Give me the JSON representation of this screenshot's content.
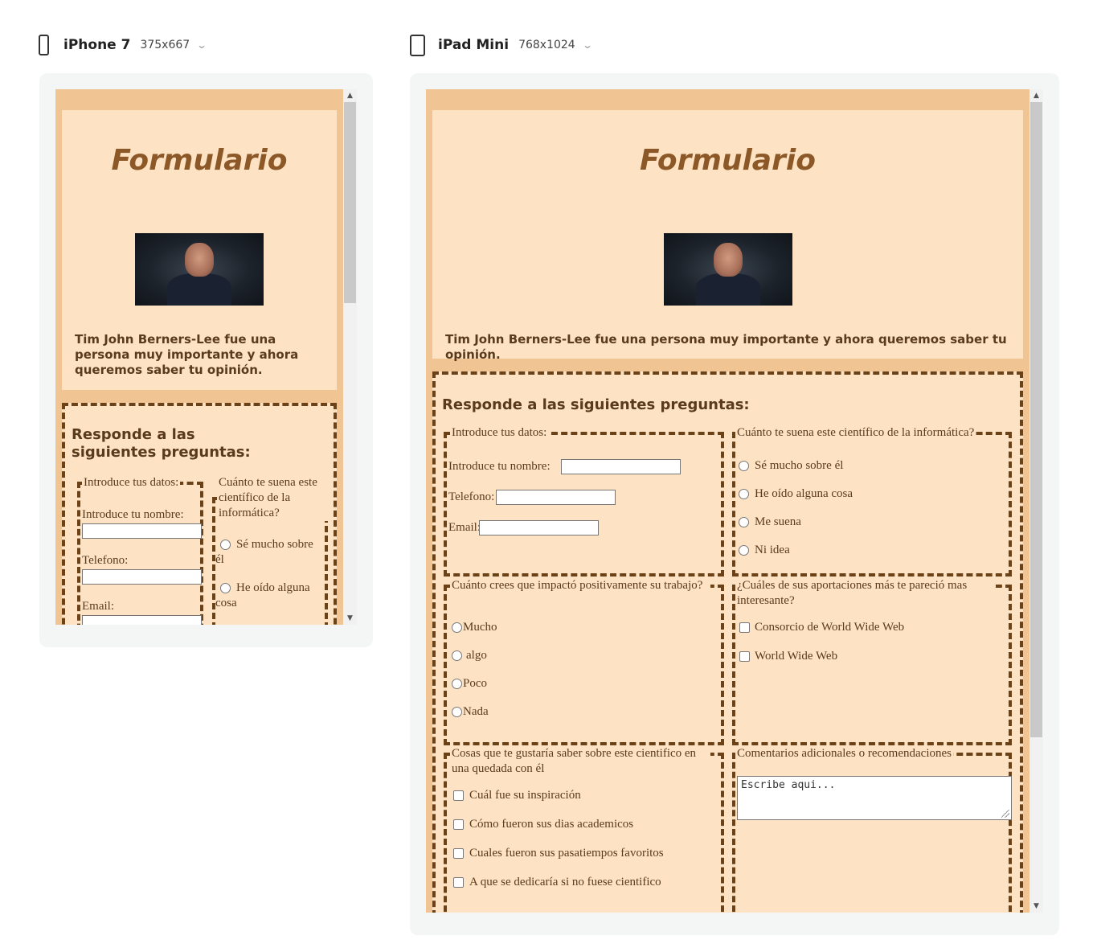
{
  "devices": [
    {
      "name": "iPhone 7",
      "resolution": "375x667"
    },
    {
      "name": "iPad Mini",
      "resolution": "768x1024"
    }
  ],
  "page": {
    "title": "Formulario",
    "intro": "Tim John Berners-Lee fue una persona muy importante y ahora queremos saber tu opinión.",
    "form_heading": "Responde a las siguientes preguntas:",
    "datos": {
      "legend": "Introduce tus datos:",
      "nombre_label": "Introduce tu nombre:",
      "telefono_label": "Telefono:",
      "email_label": "Email:"
    },
    "q1": {
      "legend": "Cuánto te suena este científico de la informática?",
      "options": [
        "Sé mucho sobre él",
        "He oído alguna cosa",
        "Me suena",
        "Ni idea"
      ]
    },
    "q2": {
      "legend": "Cuánto crees que impactó positivamente su trabajo?",
      "options": [
        "Mucho",
        "algo",
        "Poco",
        "Nada"
      ]
    },
    "q3": {
      "legend": "¿Cuáles de sus aportaciones más te pareció mas interesante?",
      "options": [
        "Consorcio de World Wide Web",
        "World Wide Web"
      ]
    },
    "q4": {
      "legend": "Cosas que te gustaría saber sobre este cientifico en una quedada con él",
      "options": [
        "Cuál fue su inspiración",
        "Cómo fueron sus dias academicos",
        "Cuales fueron sus pasatiempos favoritos",
        "A que se dedicaría si no fuese cientifico"
      ]
    },
    "q5": {
      "legend": "Comentarios adicionales o recomendaciones",
      "placeholder": "Escribe aqui..."
    }
  },
  "colors": {
    "page_bg": "#f0c493",
    "panel_bg": "#fde3c3",
    "title": "#8c5827",
    "text": "#5a3a1c",
    "dashed_border": "#6b4218"
  }
}
